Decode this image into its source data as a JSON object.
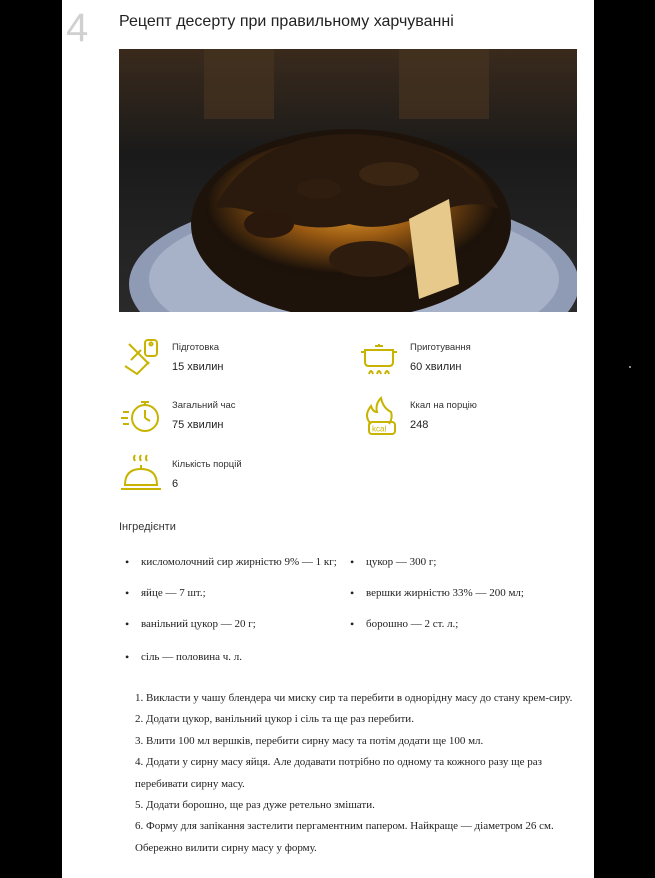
{
  "step_number": "4",
  "title": "Рецепт десерту при правильному харчуванні",
  "photo_icon": "baked-cheesecake-photo",
  "stats": [
    {
      "icon": "knife-board-icon",
      "label": "Підготовка",
      "value": "15 хвилин"
    },
    {
      "icon": "cooking-pot-icon",
      "label": "Приготування",
      "value": "60 хвилин"
    },
    {
      "icon": "stopwatch-icon",
      "label": "Загальний час",
      "value": "75 хвилин"
    },
    {
      "icon": "flame-kcal-icon",
      "label": "Ккал на порцію",
      "value": "248"
    },
    {
      "icon": "serving-cloche-icon",
      "label": "Кількість порцій",
      "value": "6"
    }
  ],
  "ingredients_title": "Інгредієнти",
  "ingredients": [
    "кисломолочний сир жирністю 9% — 1 кг;",
    "цукор — 300 г;",
    "яйце — 7 шт.;",
    "вершки жирністю 33% — 200 мл;",
    "ванільний цукор — 20 г;",
    "борошно — 2 ст. л.;",
    "сіль — половина ч. л."
  ],
  "steps": [
    "1. Викласти у чашу блендера чи миску сир та перебити в однорідну масу до стану крем-сиру.",
    "2. Додати цукор, ванільний цукор і сіль та ще раз перебити.",
    "3. Влити 100 мл вершків, перебити сирну масу та потім додати ще 100 мл.",
    "4. Додати у сирну масу яйця. Але додавати потрібно по одному та кожного разу ще раз перебивати сирну масу.",
    "5. Додати борошно, ще раз дуже ретельно змішати.",
    "6. Форму для запікання застелити пергаментним папером. Найкраще — діаметром 26 см. Обережно вилити сирну масу у форму."
  ],
  "colors": {
    "icon": "#c8b400",
    "background": "#000000",
    "page": "#ffffff"
  }
}
